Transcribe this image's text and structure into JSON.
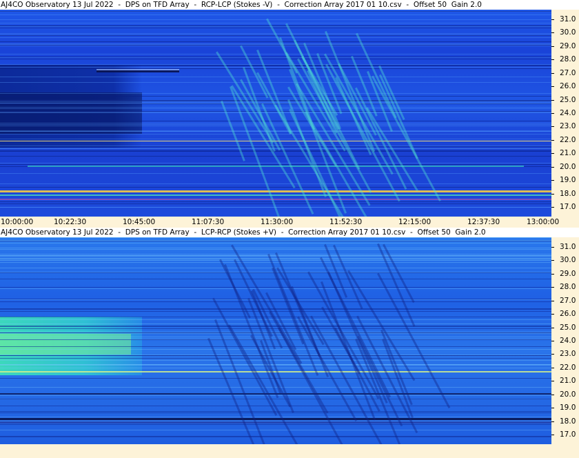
{
  "panels": [
    {
      "title": "AJ4CO Observatory 13 Jul 2022  -  DPS on TFD Array  -  RCP-LCP (Stokes -V)  -  Correction Array 2017 01 10.csv  -  Offset 50  Gain 2.0",
      "polarity": "rcp-lcp"
    },
    {
      "title": "AJ4CO Observatory 13 Jul 2022  -  DPS on TFD Array  -  LCP-RCP (Stokes +V)  -  Correction Array 2017 01 10.csv  -  Offset 50  Gain 2.0",
      "polarity": "lcp-rcp"
    }
  ],
  "chart_data": {
    "type": "heatmap",
    "x": [
      "10:00:00",
      "10:22:30",
      "10:45:00",
      "11:07:30",
      "11:30:00",
      "11:52:30",
      "12:15:00",
      "12:37:30",
      "13:00:00"
    ],
    "y_ticks": [
      "31.0",
      "30.0",
      "29.0",
      "28.0",
      "27.0",
      "26.0",
      "25.0",
      "24.0",
      "23.0",
      "22.0",
      "21.0",
      "20.0",
      "19.0",
      "18.0",
      "17.0"
    ],
    "y_range": [
      16.3,
      31.7
    ],
    "colors": {
      "background": "#1d4ce0",
      "bright": "#4fe2d0",
      "hot": "#ffd23a",
      "dark": "#0a1f80"
    }
  }
}
